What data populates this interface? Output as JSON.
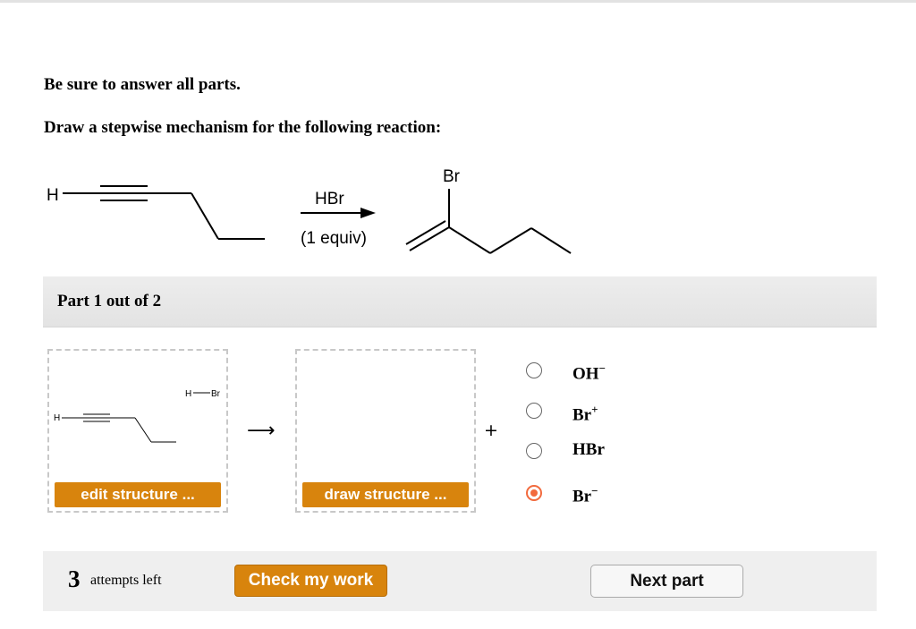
{
  "instructions": {
    "line1": "Be sure to answer all parts.",
    "line2": "Draw a stepwise mechanism for the following reaction:"
  },
  "reaction": {
    "reactant_h": "H",
    "reagent": "HBr",
    "conditions": "(1 equiv)",
    "product_br": "Br"
  },
  "part": {
    "label": "Part 1 out of 2"
  },
  "step1": {
    "reactant_h": "H",
    "hbr_h": "H",
    "hbr_br": "Br",
    "edit_button": "edit structure ...",
    "draw_button": "draw structure ...",
    "arrow": "⟶",
    "plus": "+"
  },
  "options": [
    {
      "base": "OH",
      "charge": "−",
      "selected": false
    },
    {
      "base": "Br",
      "charge": "+",
      "selected": false
    },
    {
      "base": "HBr",
      "charge": "",
      "selected": false
    },
    {
      "base": "Br",
      "charge": "−",
      "selected": true
    }
  ],
  "footer": {
    "attempts_count": "3",
    "attempts_label": "attempts left",
    "check_button": "Check my work",
    "next_button": "Next part"
  },
  "colors": {
    "accent": "#d8840d",
    "radio_selected": "#f26a3d"
  }
}
